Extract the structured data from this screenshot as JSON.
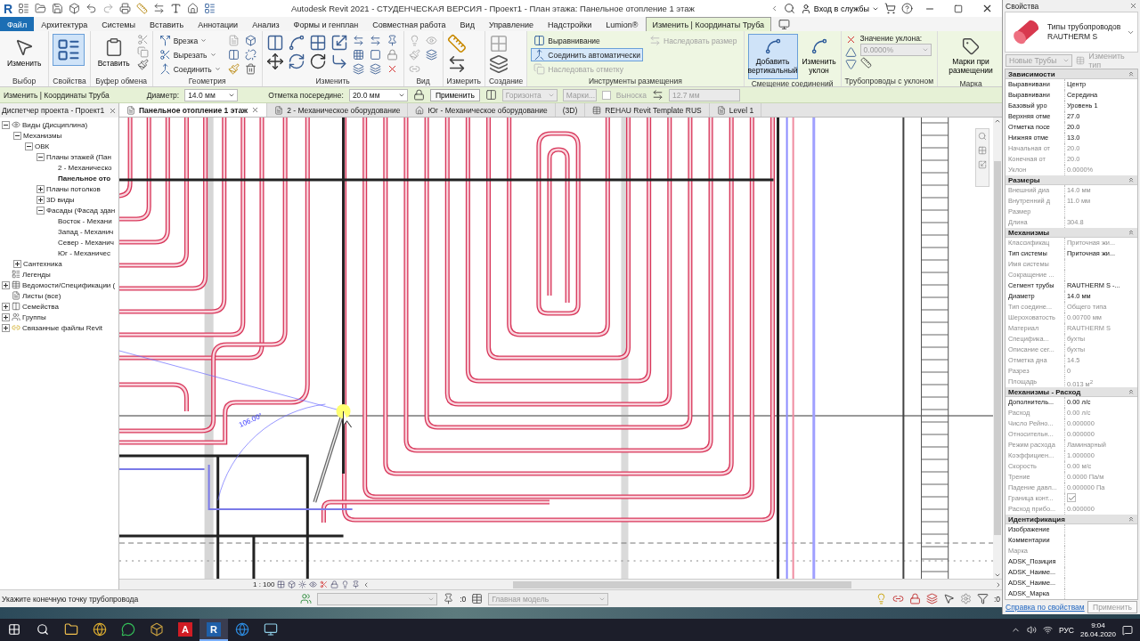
{
  "window": {
    "logo": "R",
    "title": "Autodesk Revit 2021 - СТУДЕНЧЕСКАЯ ВЕРСИЯ - Проект1 - План этажа: Панельное отопление 1 этаж",
    "sign_in": "Вход в службы"
  },
  "menu_tabs": [
    {
      "label": "Файл",
      "kind": "file",
      "selected": false
    },
    {
      "label": "Архитектура",
      "kind": "plain",
      "selected": false
    },
    {
      "label": "Системы",
      "kind": "plain",
      "selected": false
    },
    {
      "label": "Вставить",
      "kind": "plain",
      "selected": false
    },
    {
      "label": "Аннотации",
      "kind": "plain",
      "selected": false
    },
    {
      "label": "Анализ",
      "kind": "plain",
      "selected": false
    },
    {
      "label": "Формы и генплан",
      "kind": "plain",
      "selected": false
    },
    {
      "label": "Совместная работа",
      "kind": "plain",
      "selected": false
    },
    {
      "label": "Вид",
      "kind": "plain",
      "selected": false
    },
    {
      "label": "Управление",
      "kind": "plain",
      "selected": false
    },
    {
      "label": "Надстройки",
      "kind": "plain",
      "selected": false
    },
    {
      "label": "Lumion®",
      "kind": "plain",
      "selected": false
    },
    {
      "label": "Изменить | Координаты Труба",
      "kind": "context",
      "selected": true
    }
  ],
  "ribbon_panels": [
    {
      "label": "Выбор",
      "kind": "select",
      "contextual": false,
      "buttons": [
        {
          "label": "Изменить",
          "selected": false
        }
      ]
    },
    {
      "label": "Свойства",
      "kind": "properties",
      "contextual": false,
      "buttons": [
        {
          "selected": true
        }
      ]
    },
    {
      "label": "Буфер обмена",
      "kind": "clipboard",
      "contextual": false,
      "buttons": [
        {
          "label": "Вставить",
          "selected": false
        }
      ]
    },
    {
      "label": "Геометрия",
      "kind": "geometry",
      "contextual": false,
      "buttons": [
        {
          "label": "Врезка",
          "selected": false
        },
        {
          "label": "Вырезать",
          "selected": false
        },
        {
          "label": "Соединить",
          "selected": false
        }
      ]
    },
    {
      "label": "Изменить",
      "kind": "modify",
      "contextual": false
    },
    {
      "label": "Вид",
      "kind": "view",
      "contextual": false
    },
    {
      "label": "Измерить",
      "kind": "measure",
      "contextual": false
    },
    {
      "label": "Создание",
      "kind": "create",
      "contextual": false
    },
    {
      "label": "Инструменты размещения",
      "kind": "placement",
      "contextual": true,
      "buttons": [
        {
          "label": "Выравнивание",
          "selected": false,
          "disabled": false
        },
        {
          "label": "Соединить автоматически",
          "selected": true,
          "disabled": false
        },
        {
          "label": "Наследовать отметку",
          "selected": false,
          "disabled": true
        },
        {
          "label": "Наследовать размер",
          "selected": false,
          "disabled": true
        }
      ]
    },
    {
      "label": "Смещение соединений",
      "kind": "offset",
      "contextual": true,
      "buttons": [
        {
          "label": "Добавить вертикальный",
          "selected": true
        },
        {
          "label": "Изменить уклон",
          "selected": false
        }
      ]
    },
    {
      "label": "Трубопроводы с уклоном",
      "kind": "slope",
      "contextual": true,
      "field_label": "Значение уклона:",
      "field_value": "0.0000%"
    },
    {
      "label": "Марка",
      "kind": "tag",
      "contextual": true,
      "buttons": [
        {
          "label": "Марки при размещении",
          "selected": false
        }
      ]
    }
  ],
  "options_bar": {
    "context": "Изменить | Координаты Труба",
    "diameter_label": "Диаметр:",
    "diameter": "14.0 мм",
    "offset_label": "Отметка посередине:",
    "offset": "20.0 мм",
    "apply": "Применить",
    "justify": {
      "value": "Горизонта",
      "disabled": true
    },
    "tags": {
      "value": "Марки...",
      "disabled": true
    },
    "leader": {
      "label": "Выноска",
      "checked": false,
      "disabled": true
    },
    "length": {
      "value": "12.7 мм",
      "disabled": true
    }
  },
  "project_browser": {
    "title": "Диспетчер проекта - Проект1",
    "tree": [
      {
        "label": "Виды (Дисциплина)",
        "kind": "views",
        "expanded": true,
        "selected": false,
        "children": [
          {
            "label": "Механизмы",
            "expanded": true,
            "selected": false,
            "children": [
              {
                "label": "ОВК",
                "expanded": true,
                "selected": false,
                "children": [
                  {
                    "label": "Планы этажей (Пан",
                    "expanded": true,
                    "selected": false,
                    "children": [
                      {
                        "label": "2 - Механическо",
                        "selected": false
                      },
                      {
                        "label": "Панельное ото",
                        "selected": true
                      }
                    ]
                  },
                  {
                    "label": "Планы потолков",
                    "expanded": false,
                    "selected": false
                  },
                  {
                    "label": "3D виды",
                    "expanded": false,
                    "selected": false
                  },
                  {
                    "label": "Фасады (Фасад здан",
                    "expanded": true,
                    "selected": false,
                    "children": [
                      {
                        "label": "Восток - Механи",
                        "selected": false
                      },
                      {
                        "label": "Запад - Механич",
                        "selected": false
                      },
                      {
                        "label": "Север - Механич",
                        "selected": false
                      },
                      {
                        "label": "Юг - Механичес",
                        "selected": false
                      }
                    ]
                  }
                ]
              }
            ]
          },
          {
            "label": "Сантехника",
            "expanded": false,
            "selected": false
          }
        ]
      },
      {
        "label": "Легенды",
        "kind": "legend",
        "selected": false
      },
      {
        "label": "Ведомости/Спецификации (",
        "kind": "schedule",
        "expanded": false,
        "selected": false
      },
      {
        "label": "Листы (все)",
        "kind": "sheet",
        "selected": false
      },
      {
        "label": "Семейства",
        "kind": "family",
        "expanded": false,
        "selected": false
      },
      {
        "label": "Группы",
        "kind": "group",
        "expanded": false,
        "selected": false
      },
      {
        "label": "Связанные файлы Revit",
        "kind": "link",
        "expanded": false,
        "selected": false
      }
    ]
  },
  "view_tabs": [
    {
      "label": "Панельное отопление 1 этаж",
      "kind": "plan",
      "selected": true
    },
    {
      "label": "2 - Механическое оборудование",
      "kind": "plan",
      "selected": false
    },
    {
      "label": "Юг - Механическое оборудование",
      "kind": "elevation",
      "selected": false
    },
    {
      "label": "(3D)",
      "kind": "cube",
      "selected": false
    },
    {
      "label": "REHAU Revit Template RUS",
      "kind": "sheet",
      "selected": false
    },
    {
      "label": "Level 1",
      "kind": "plan",
      "selected": false
    }
  ],
  "canvas": {
    "angle_label": "106.00°"
  },
  "view_bar": {
    "scale": "1 : 100"
  },
  "status_bar": {
    "prompt": "Укажите конечную точку трубопровода",
    "worksets": ":0",
    "model": "Главная модель",
    "filter": ":0"
  },
  "properties": {
    "title": "Свойства",
    "type_family": "Типы трубопроводов",
    "type_name": "RAUTHERM S",
    "type_selector": "Новые Трубы",
    "edit_type": "Изменить тип",
    "sections": [
      {
        "title": "Зависимости",
        "rows": [
          {
            "label": "Выравнивани",
            "value": "Центр",
            "kind": "text",
            "disabled": false
          },
          {
            "label": "Выравнивани",
            "value": "Середина",
            "kind": "text",
            "disabled": false
          },
          {
            "label": "Базовый уро",
            "value": "Уровень 1",
            "kind": "text",
            "disabled": false
          },
          {
            "label": "Верхняя отме",
            "value": "27.0",
            "kind": "text",
            "disabled": false
          },
          {
            "label": "Отметка посе",
            "value": "20.0",
            "kind": "text",
            "disabled": false
          },
          {
            "label": "Нижняя отме",
            "value": "13.0",
            "kind": "text",
            "disabled": false
          },
          {
            "label": "Начальная от",
            "value": "20.0",
            "kind": "text",
            "disabled": true
          },
          {
            "label": "Конечная от",
            "value": "20.0",
            "kind": "text",
            "disabled": true
          },
          {
            "label": "Уклон",
            "value": "0.0000%",
            "kind": "text",
            "disabled": true
          }
        ]
      },
      {
        "title": "Размеры",
        "rows": [
          {
            "label": "Внешний диа",
            "value": "14.0 мм",
            "kind": "text",
            "disabled": true
          },
          {
            "label": "Внутренний д",
            "value": "11.0 мм",
            "kind": "text",
            "disabled": true
          },
          {
            "label": "Размер",
            "kind": "text",
            "disabled": true
          },
          {
            "label": "Длина",
            "value": "304.8",
            "kind": "text",
            "disabled": true
          }
        ]
      },
      {
        "title": "Механизмы",
        "rows": [
          {
            "label": "Классификац",
            "value": "Приточная жи...",
            "kind": "text",
            "disabled": true
          },
          {
            "label": "Тип системы",
            "value": "Приточная жи...",
            "kind": "text",
            "disabled": false
          },
          {
            "label": "Имя системы",
            "kind": "text",
            "disabled": true
          },
          {
            "label": "Сокращение ...",
            "kind": "text",
            "disabled": true
          },
          {
            "label": "Сегмент трубы",
            "value": "RAUTHERM S -...",
            "kind": "text",
            "disabled": false
          },
          {
            "label": "Диаметр",
            "value": "14.0 мм",
            "kind": "text",
            "disabled": false
          },
          {
            "label": "Тип соедине...",
            "value": "Общего типа",
            "kind": "text",
            "disabled": true
          },
          {
            "label": "Шероховатость",
            "value": "0.00700 мм",
            "kind": "text",
            "disabled": true
          },
          {
            "label": "Материал",
            "value": "RAUTHERM S",
            "kind": "text",
            "disabled": true
          },
          {
            "label": "Специфика...",
            "value": "бухты",
            "kind": "text",
            "disabled": true
          },
          {
            "label": "Описание сег...",
            "value": "бухты",
            "kind": "text",
            "disabled": true
          },
          {
            "label": "Отметка дна",
            "value": "14.5",
            "kind": "text",
            "disabled": true
          },
          {
            "label": "Разрез",
            "value": "0",
            "kind": "text",
            "disabled": true
          },
          {
            "label": "Площадь",
            "value": "0.013 м$^{2}$",
            "kind": "text",
            "disabled": true
          }
        ]
      },
      {
        "title": "Механизмы - Расход",
        "rows": [
          {
            "label": "Дополнитель...",
            "value": "0.00 л/с",
            "kind": "text",
            "disabled": false
          },
          {
            "label": "Расход",
            "value": "0.00 л/с",
            "kind": "text",
            "disabled": true
          },
          {
            "label": "Число Рейно...",
            "value": "0.000000",
            "kind": "text",
            "disabled": true
          },
          {
            "label": "Относительн...",
            "value": "0.000000",
            "kind": "text",
            "disabled": true
          },
          {
            "label": "Режим расхода",
            "value": "Ламинарный",
            "kind": "text",
            "disabled": true
          },
          {
            "label": "Коэффициен...",
            "value": "1.000000",
            "kind": "text",
            "disabled": true
          },
          {
            "label": "Скорость",
            "value": "0.00 м/с",
            "kind": "text",
            "disabled": true
          },
          {
            "label": "Трение",
            "value": "0.0000 Па/м",
            "kind": "text",
            "disabled": true
          },
          {
            "label": "Падение давл...",
            "value": "0.000000 Па",
            "kind": "text",
            "disabled": true
          },
          {
            "label": "Граница конт...",
            "checked": true,
            "kind": "check",
            "disabled": true
          },
          {
            "label": "Расход прибо...",
            "value": "0.000000",
            "kind": "text",
            "disabled": true
          }
        ]
      },
      {
        "title": "Идентификация",
        "rows": [
          {
            "label": "Изображение",
            "kind": "text",
            "disabled": false
          },
          {
            "label": "Комментарии",
            "kind": "text",
            "disabled": false
          },
          {
            "label": "Марка",
            "kind": "text",
            "disabled": true
          },
          {
            "label": "ADSK_Позиция",
            "kind": "text",
            "disabled": false
          },
          {
            "label": "ADSK_Наиме...",
            "kind": "text",
            "disabled": false
          },
          {
            "label": "ADSK_Наиме...",
            "kind": "text",
            "disabled": false
          },
          {
            "label": "ADSK_Марка",
            "kind": "text",
            "disabled": false
          }
        ]
      }
    ],
    "help": "Справка по свойствам",
    "apply": "Применить"
  },
  "taskbar": {
    "apps": [
      {
        "kind": "folder",
        "selected": false
      },
      {
        "kind": "browser",
        "selected": false
      },
      {
        "kind": "chat",
        "selected": false
      },
      {
        "kind": "app",
        "selected": false
      },
      {
        "kind": "letter",
        "glyph": "A",
        "color": "#d01c24",
        "selected": false
      },
      {
        "kind": "letter",
        "glyph": "R",
        "color": "#1f5fa8",
        "selected": true
      },
      {
        "kind": "edge",
        "selected": false
      },
      {
        "kind": "screen",
        "selected": false
      }
    ],
    "language": "РУС",
    "time": "9:04",
    "date": "26.04.2020"
  }
}
